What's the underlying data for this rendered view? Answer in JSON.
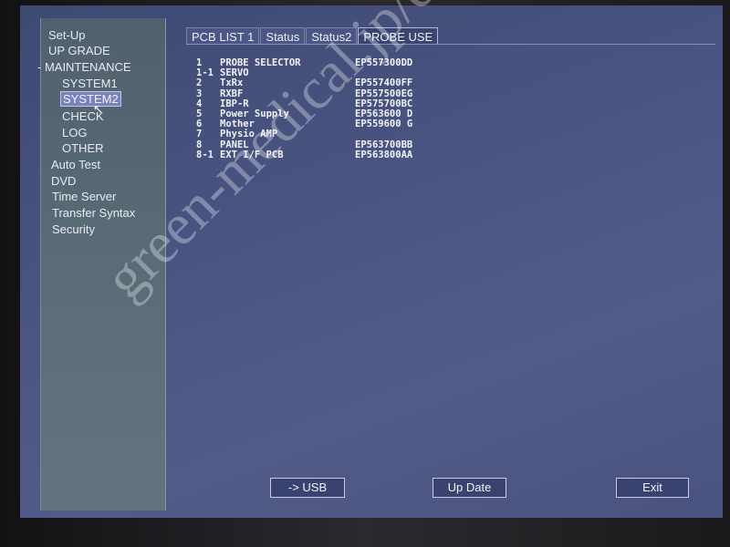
{
  "sidebar": {
    "items": [
      {
        "label": "Set-Up"
      },
      {
        "label": "UP GRADE"
      },
      {
        "label": "-  MAINTENANCE"
      },
      {
        "label": "SYSTEM1"
      },
      {
        "label": "SYSTEM2",
        "selected": true
      },
      {
        "label": "CHECK"
      },
      {
        "label": "LOG"
      },
      {
        "label": "OTHER"
      },
      {
        "label": "Auto Test"
      },
      {
        "label": "DVD"
      },
      {
        "label": "Time Server"
      },
      {
        "label": "Transfer Syntax"
      },
      {
        "label": "Security"
      }
    ]
  },
  "tabs": [
    {
      "label": "PCB LIST 1"
    },
    {
      "label": "Status"
    },
    {
      "label": "Status2"
    },
    {
      "label": "PROBE USE",
      "active": true
    }
  ],
  "pcb_list": [
    {
      "no": "1",
      "name": "PROBE SELECTOR",
      "code": "EP557300DD"
    },
    {
      "no": "1-1",
      "name": "SERVO",
      "code": ""
    },
    {
      "no": "2",
      "name": "TxRx",
      "code": "EP557400FF"
    },
    {
      "no": "3",
      "name": "RXBF",
      "code": "EP557500EG"
    },
    {
      "no": "4",
      "name": "IBP-R",
      "code": "EP575700BC"
    },
    {
      "no": "5",
      "name": "Power Supply",
      "code": "EP563600 D"
    },
    {
      "no": "6",
      "name": "Mother",
      "code": "EP559600 G"
    },
    {
      "no": "7",
      "name": "Physio AMP",
      "code": ""
    },
    {
      "no": "8",
      "name": "PANEL",
      "code": "EP563700BB"
    },
    {
      "no": "8-1",
      "name": "EXT I/F PCB",
      "code": "EP563800AA"
    }
  ],
  "buttons": {
    "usb": "-> USB",
    "update": "Up Date",
    "exit": "Exit"
  },
  "watermark": "green-medical.jp/en"
}
